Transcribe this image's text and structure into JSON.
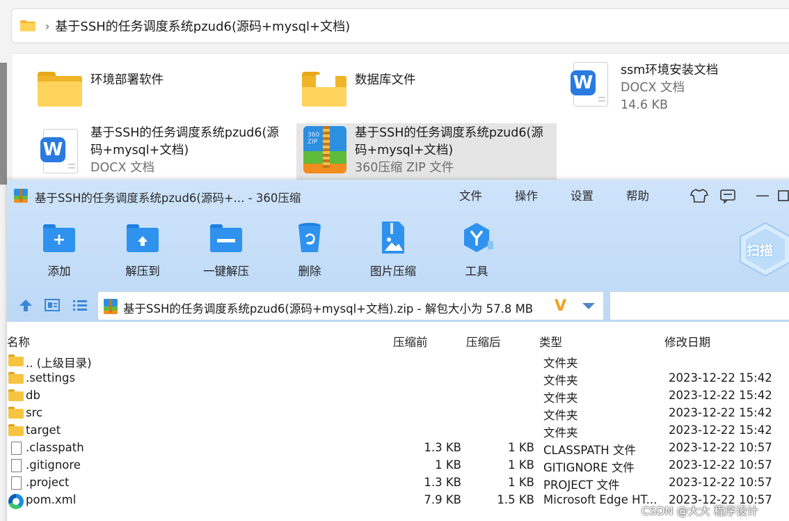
{
  "explorer": {
    "breadcrumb": "基于SSH的任务调度系统pzud6(源码+mysql+文档)",
    "chevron": "›",
    "items": [
      {
        "name": "环境部署软件",
        "icon": "folder-icon"
      },
      {
        "name": "数据库文件",
        "icon": "folder-with-document-icon"
      },
      {
        "name": "ssm环境安装文档",
        "type": "DOCX 文档",
        "size": "14.6 KB",
        "icon": "wps-docx-icon"
      },
      {
        "name_line1": "基于SSH的任务调度系统pzud6(源",
        "name_line2": "码+mysql+文档)",
        "type": "DOCX 文档",
        "icon": "wps-docx-icon"
      },
      {
        "name_line1": "基于SSH的任务调度系统pzud6(源",
        "name_line2": "码+mysql+文档)",
        "type": "360压缩 ZIP 文件",
        "icon": "360-zip-icon"
      }
    ]
  },
  "archiver": {
    "title": "基于SSH的任务调度系统pzud6(源码+... - 360压缩",
    "menu": [
      "文件",
      "操作",
      "设置",
      "帮助"
    ],
    "window_controls": {
      "minimize": "—"
    },
    "toolbar": [
      {
        "label": "添加",
        "icon": "add-folder-icon"
      },
      {
        "label": "解压到",
        "icon": "extract-to-folder-icon"
      },
      {
        "label": "一键解压",
        "icon": "one-click-extract-icon"
      },
      {
        "label": "删除",
        "icon": "recycle-bin-icon"
      },
      {
        "label": "图片压缩",
        "icon": "image-compress-icon"
      },
      {
        "label": "工具",
        "icon": "tools-icon"
      }
    ],
    "scan_label": "扫描",
    "path": "基于SSH的任务调度系统pzud6(源码+mysql+文档).zip - 解包大小为 57.8 MB",
    "path_logo": "V",
    "columns": [
      "名称",
      "压缩前",
      "压缩后",
      "类型",
      "修改日期"
    ],
    "rows": [
      {
        "name": ".. (上级目录)",
        "before": "",
        "after": "",
        "type": "文件夹",
        "date": "",
        "icon": "folder-icon"
      },
      {
        "name": ".settings",
        "before": "",
        "after": "",
        "type": "文件夹",
        "date": "2023-12-22 15:42",
        "icon": "folder-icon"
      },
      {
        "name": "db",
        "before": "",
        "after": "",
        "type": "文件夹",
        "date": "2023-12-22 15:42",
        "icon": "folder-icon"
      },
      {
        "name": "src",
        "before": "",
        "after": "",
        "type": "文件夹",
        "date": "2023-12-22 15:42",
        "icon": "folder-icon"
      },
      {
        "name": "target",
        "before": "",
        "after": "",
        "type": "文件夹",
        "date": "2023-12-22 15:42",
        "icon": "folder-icon"
      },
      {
        "name": ".classpath",
        "before": "1.3 KB",
        "after": "1 KB",
        "type": "CLASSPATH 文件",
        "date": "2023-12-22 10:57",
        "icon": "file-icon"
      },
      {
        "name": ".gitignore",
        "before": "1 KB",
        "after": "1 KB",
        "type": "GITIGNORE 文件",
        "date": "2023-12-22 10:57",
        "icon": "file-icon"
      },
      {
        "name": ".project",
        "before": "1.3 KB",
        "after": "1 KB",
        "type": "PROJECT 文件",
        "date": "2023-12-22 10:57",
        "icon": "file-icon"
      },
      {
        "name": "pom.xml",
        "before": "7.9 KB",
        "after": "1.5 KB",
        "type": "Microsoft Edge HT...",
        "date": "2023-12-22 10:57",
        "icon": "edge-icon"
      }
    ]
  },
  "watermark": "CSDN @大大 程序设计"
}
